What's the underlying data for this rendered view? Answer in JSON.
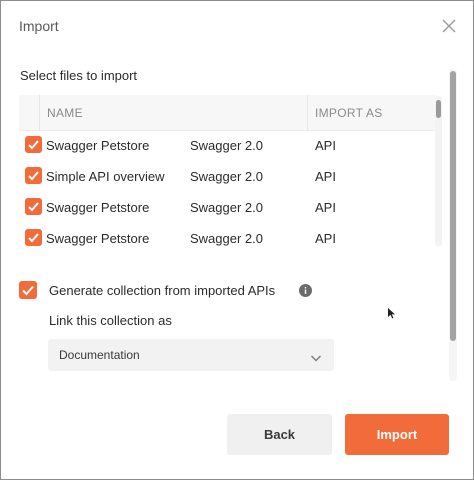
{
  "dialog": {
    "title": "Import",
    "close_icon": "close-icon"
  },
  "files": {
    "section_label": "Select files to import",
    "columns": {
      "name": "NAME",
      "import_as": "IMPORT AS"
    },
    "rows": [
      {
        "name": "Swagger Petstore",
        "format": "Swagger 2.0",
        "import_as": "API",
        "checked": true
      },
      {
        "name": "Simple API overview",
        "format": "Swagger 2.0",
        "import_as": "API",
        "checked": true
      },
      {
        "name": "Swagger Petstore",
        "format": "Swagger 2.0",
        "import_as": "API",
        "checked": true
      },
      {
        "name": "Swagger Petstore",
        "format": "Swagger 2.0",
        "import_as": "API",
        "checked": true
      }
    ]
  },
  "generate": {
    "label": "Generate collection from imported APIs",
    "checked": true,
    "info_icon": "info-icon"
  },
  "link": {
    "label": "Link this collection as",
    "selected": "Documentation"
  },
  "footer": {
    "back_label": "Back",
    "import_label": "Import"
  },
  "colors": {
    "accent": "#f26b3a",
    "secondary_button": "#f0f0f0"
  }
}
